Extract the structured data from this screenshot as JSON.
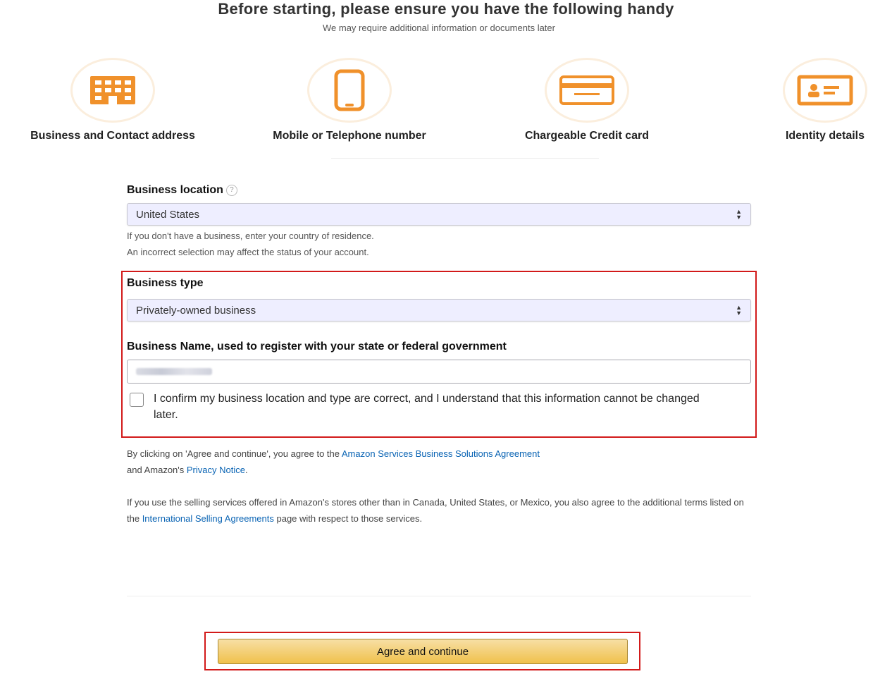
{
  "header": {
    "title": "Before starting, please ensure you have the following handy",
    "subtitle": "We may require additional information or documents later"
  },
  "requirements": [
    {
      "label": "Business and Contact address",
      "icon": "building-icon"
    },
    {
      "label": "Mobile or Telephone number",
      "icon": "phone-icon"
    },
    {
      "label": "Chargeable Credit card",
      "icon": "credit-card-icon"
    },
    {
      "label": "Identity details",
      "icon": "id-card-icon"
    }
  ],
  "business_location": {
    "label": "Business location",
    "value": "United States",
    "hint_line1": "If you don't have a business, enter your country of residence.",
    "hint_line2": "An incorrect selection may affect the status of your account."
  },
  "business_type": {
    "label": "Business type",
    "value": "Privately-owned business"
  },
  "business_name": {
    "label": "Business Name, used to register with your state or federal government"
  },
  "confirm": {
    "text": "I confirm my business location and type are correct, and I understand that this information cannot be changed later."
  },
  "legal": {
    "p1_prefix": "By clicking on 'Agree and continue', you agree to the ",
    "p1_link": "Amazon Services Business Solutions Agreement",
    "p1_middle": "and Amazon's ",
    "p1_link2": "Privacy Notice",
    "p1_end": ".",
    "p2_prefix": "If you use the selling services offered in Amazon's stores other than in Canada, United States, or Mexico, you also agree to the additional terms listed on the ",
    "p2_link": "International Selling Agreements",
    "p2_suffix": " page with respect to those services."
  },
  "cta": {
    "label": "Agree and continue"
  },
  "colors": {
    "accent_orange": "#f0912b",
    "highlight_red": "#d21a1a",
    "link_blue": "#0a64b4",
    "button_yellow": "#f0c14b"
  }
}
